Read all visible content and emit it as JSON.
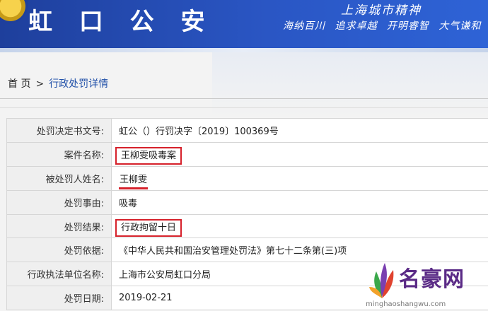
{
  "header": {
    "brand": "虹 口 公 安",
    "spirit_title": "上海城市精神",
    "spirit_motto": "海纳百川 追求卓越 开明睿智 大气谦和"
  },
  "breadcrumb": {
    "home": "首 页",
    "separator": ">",
    "current": "行政处罚详情"
  },
  "detail_rows": [
    {
      "label": "处罚决定书文号:",
      "value": "虹公（）行罚决字〔2019〕100369号",
      "highlight": "none"
    },
    {
      "label": "案件名称:",
      "value": "王柳雯吸毒案",
      "highlight": "box"
    },
    {
      "label": "被处罚人姓名:",
      "value": "王柳雯",
      "highlight": "underline"
    },
    {
      "label": "处罚事由:",
      "value": "吸毒",
      "highlight": "none"
    },
    {
      "label": "处罚结果:",
      "value": "行政拘留十日",
      "highlight": "box"
    },
    {
      "label": "处罚依据:",
      "value": "《中华人民共和国治安管理处罚法》第七十二条第(三)项",
      "highlight": "none"
    },
    {
      "label": "行政执法单位名称:",
      "value": "上海市公安局虹口分局",
      "highlight": "none"
    },
    {
      "label": "处罚日期:",
      "value": "2019-02-21",
      "highlight": "none"
    }
  ],
  "watermark": {
    "title": "名豪网",
    "url": "minghaoshangwu.com",
    "icon": "leaf-logo-icon"
  },
  "colors": {
    "banner": "#2a56c4",
    "highlight_red": "#d6212b",
    "label_bg": "#efefef",
    "watermark": "#5a2a86"
  }
}
